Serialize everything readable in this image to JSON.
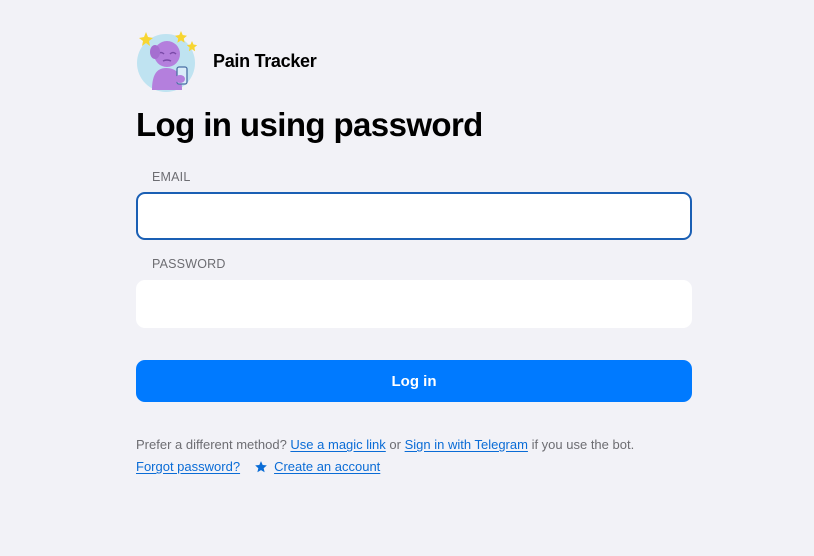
{
  "app": {
    "name": "Pain Tracker",
    "logo_icon": "sticker-character-with-phone-icon"
  },
  "page": {
    "title": "Log in using password"
  },
  "form": {
    "email_label": "EMAIL",
    "email_value": "",
    "email_placeholder": "",
    "password_label": "PASSWORD",
    "password_value": "",
    "password_placeholder": "",
    "submit_label": "Log in"
  },
  "alternatives": {
    "prefix": "Prefer a different method?",
    "magic_link": "Use a magic link",
    "or": "or",
    "telegram": "Sign in with Telegram",
    "suffix": "if you use the bot."
  },
  "links": {
    "forgot_password": "Forgot password?",
    "create_account": "Create an account",
    "create_account_icon": "star-icon"
  },
  "colors": {
    "background": "#f2f2f7",
    "accent": "#007aff",
    "link": "#0a6cd6",
    "focus_border": "#1a5fb4",
    "label": "#6d6d72"
  }
}
